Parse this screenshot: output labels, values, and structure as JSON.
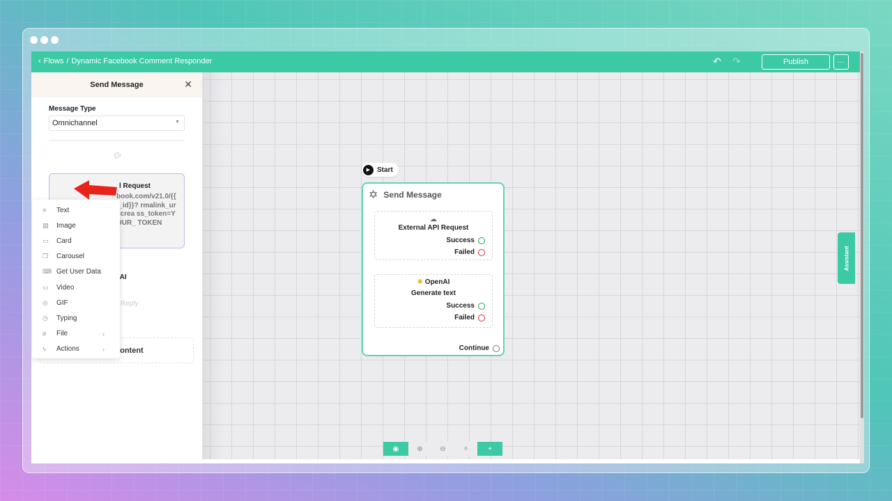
{
  "breadcrumb": {
    "root": "Flows",
    "separator": "/",
    "current": "Dynamic Facebook Comment Responder"
  },
  "header": {
    "publish_label": "Publish",
    "more_label": "···"
  },
  "sidebar": {
    "title": "Send Message",
    "message_type_label": "Message Type",
    "message_type_value": "Omnichannel",
    "api_card": {
      "title": "l Request",
      "url": "book.com/v21.0/{{ t_id}}? rmalink_url,crea ss_token=YOUR_ TOKEN"
    },
    "openai_label": "enAI",
    "reply_ghost": "Reply",
    "add_content_label": "Add Content"
  },
  "menu": {
    "items": [
      {
        "label": "Text",
        "icon": "text-lines-icon"
      },
      {
        "label": "Image",
        "icon": "image-icon"
      },
      {
        "label": "Card",
        "icon": "card-icon"
      },
      {
        "label": "Carousel",
        "icon": "carousel-icon"
      },
      {
        "label": "Get User Data",
        "icon": "keyboard-icon"
      },
      {
        "label": "Video",
        "icon": "video-icon"
      },
      {
        "label": "GIF",
        "icon": "gif-icon"
      },
      {
        "label": "Typing",
        "icon": "clock-icon"
      },
      {
        "label": "File",
        "icon": "paperclip-icon",
        "has_submenu": true
      },
      {
        "label": "Actions",
        "icon": "bolt-icon",
        "has_submenu": true
      }
    ]
  },
  "canvas": {
    "start_label": "Start",
    "node": {
      "title": "Send Message",
      "api_block": {
        "title": "External API Request",
        "success": "Success",
        "failed": "Failed"
      },
      "openai_block": {
        "title": "OpenAI",
        "subtitle": "Generate text",
        "success": "Success",
        "failed": "Failed"
      },
      "continue_label": "Continue"
    },
    "assistant_label": "Assistant",
    "add_label": "+"
  },
  "colors": {
    "accent": "#3ccaa4",
    "success": "#22a447",
    "failed": "#e0272f",
    "arrow": "#e8231c"
  }
}
